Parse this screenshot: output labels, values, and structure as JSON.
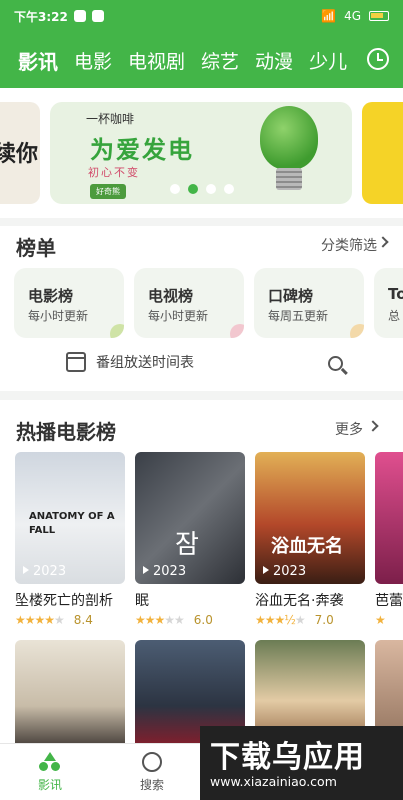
{
  "status_bar": {
    "time": "下午3:22",
    "network": "4G"
  },
  "top_nav": {
    "tabs": [
      {
        "label": "影讯",
        "active": true
      },
      {
        "label": "电影"
      },
      {
        "label": "电视剧"
      },
      {
        "label": "综艺"
      },
      {
        "label": "动漫"
      },
      {
        "label": "少儿"
      }
    ],
    "icon": "clock-icon"
  },
  "banner": {
    "left_partial_text": "续你",
    "main": {
      "top_text": "一杯咖啡",
      "title": "为爱发电",
      "subtitle": "初心不变",
      "brand": "好奇熊"
    },
    "pagination": {
      "count": 4,
      "active_index": 1
    },
    "colors": {
      "main_bg": "#e8f2e2",
      "right_card": "#f5d327"
    }
  },
  "ranking": {
    "title": "榜单",
    "filter_label": "分类筛选",
    "cards": [
      {
        "title": "电影榜",
        "subtitle": "每小时更新",
        "accent": "#cfe3a6"
      },
      {
        "title": "电视榜",
        "subtitle": "每小时更新",
        "accent": "#f2c7cf"
      },
      {
        "title": "口碑榜",
        "subtitle": "每周五更新",
        "accent": "#f3d9a9"
      },
      {
        "title": "To",
        "subtitle": "总"
      }
    ],
    "schedule_label": "番组放送时间表"
  },
  "hot_movies": {
    "title": "热播电影榜",
    "more_label": "更多",
    "items": [
      {
        "name": "坠楼死亡的剖析",
        "year": "2023",
        "rating": "8.4",
        "stars": 4,
        "poster_text": "ANATOMY OF A FALL",
        "bg": "#e7e9ec"
      },
      {
        "name": "眠",
        "year": "2023",
        "rating": "6.0",
        "stars": 3,
        "poster_text": "잠",
        "bg": "#4a4f56"
      },
      {
        "name": "浴血无名·奔袭",
        "year": "2023",
        "rating": "7.0",
        "stars": 3.5,
        "poster_text": "浴血无名",
        "bg": "#b3482a"
      },
      {
        "name": "芭蕾",
        "year": "",
        "rating": "",
        "stars": 0,
        "poster_text": "",
        "bg": "#c0387a"
      }
    ]
  },
  "bottom_nav": {
    "items": [
      {
        "label": "影讯",
        "active": true
      },
      {
        "label": "搜索"
      }
    ]
  },
  "watermark": {
    "title": "下载乌应用",
    "url": "www.xiazainiao.com"
  }
}
